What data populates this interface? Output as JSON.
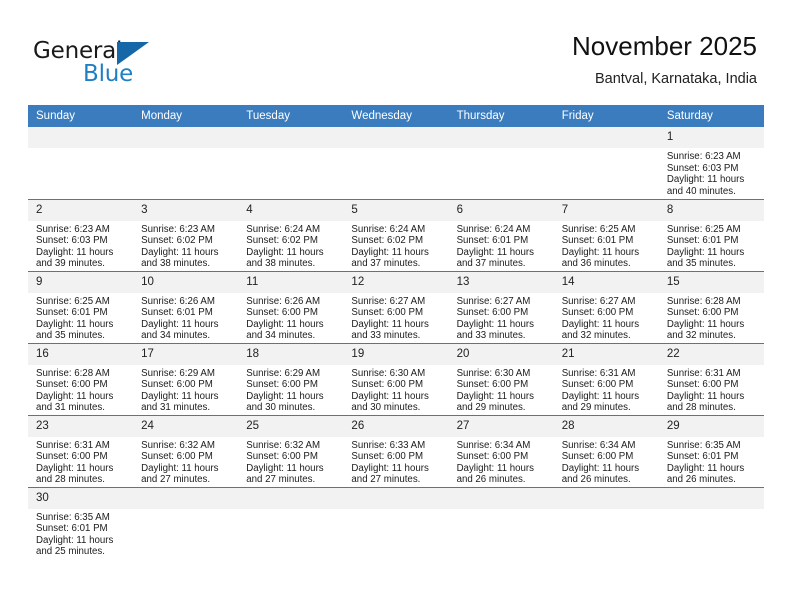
{
  "brand": {
    "name_part1": "General",
    "name_part2": "Blue",
    "logo_icon": "blue-triangle-logo",
    "accent_color": "#1567a8"
  },
  "header": {
    "title": "November 2025",
    "subtitle": "Bantval, Karnataka, India"
  },
  "calendar": {
    "header_bg": "#3a7cbe",
    "daynum_bg": "#f2f2f2",
    "weekdays": [
      "Sunday",
      "Monday",
      "Tuesday",
      "Wednesday",
      "Thursday",
      "Friday",
      "Saturday"
    ],
    "weeks": [
      [
        {
          "day": "",
          "lines": []
        },
        {
          "day": "",
          "lines": []
        },
        {
          "day": "",
          "lines": []
        },
        {
          "day": "",
          "lines": []
        },
        {
          "day": "",
          "lines": []
        },
        {
          "day": "",
          "lines": []
        },
        {
          "day": "1",
          "lines": [
            "Sunrise: 6:23 AM",
            "Sunset: 6:03 PM",
            "Daylight: 11 hours",
            "and 40 minutes."
          ]
        }
      ],
      [
        {
          "day": "2",
          "lines": [
            "Sunrise: 6:23 AM",
            "Sunset: 6:03 PM",
            "Daylight: 11 hours",
            "and 39 minutes."
          ]
        },
        {
          "day": "3",
          "lines": [
            "Sunrise: 6:23 AM",
            "Sunset: 6:02 PM",
            "Daylight: 11 hours",
            "and 38 minutes."
          ]
        },
        {
          "day": "4",
          "lines": [
            "Sunrise: 6:24 AM",
            "Sunset: 6:02 PM",
            "Daylight: 11 hours",
            "and 38 minutes."
          ]
        },
        {
          "day": "5",
          "lines": [
            "Sunrise: 6:24 AM",
            "Sunset: 6:02 PM",
            "Daylight: 11 hours",
            "and 37 minutes."
          ]
        },
        {
          "day": "6",
          "lines": [
            "Sunrise: 6:24 AM",
            "Sunset: 6:01 PM",
            "Daylight: 11 hours",
            "and 37 minutes."
          ]
        },
        {
          "day": "7",
          "lines": [
            "Sunrise: 6:25 AM",
            "Sunset: 6:01 PM",
            "Daylight: 11 hours",
            "and 36 minutes."
          ]
        },
        {
          "day": "8",
          "lines": [
            "Sunrise: 6:25 AM",
            "Sunset: 6:01 PM",
            "Daylight: 11 hours",
            "and 35 minutes."
          ]
        }
      ],
      [
        {
          "day": "9",
          "lines": [
            "Sunrise: 6:25 AM",
            "Sunset: 6:01 PM",
            "Daylight: 11 hours",
            "and 35 minutes."
          ]
        },
        {
          "day": "10",
          "lines": [
            "Sunrise: 6:26 AM",
            "Sunset: 6:01 PM",
            "Daylight: 11 hours",
            "and 34 minutes."
          ]
        },
        {
          "day": "11",
          "lines": [
            "Sunrise: 6:26 AM",
            "Sunset: 6:00 PM",
            "Daylight: 11 hours",
            "and 34 minutes."
          ]
        },
        {
          "day": "12",
          "lines": [
            "Sunrise: 6:27 AM",
            "Sunset: 6:00 PM",
            "Daylight: 11 hours",
            "and 33 minutes."
          ]
        },
        {
          "day": "13",
          "lines": [
            "Sunrise: 6:27 AM",
            "Sunset: 6:00 PM",
            "Daylight: 11 hours",
            "and 33 minutes."
          ]
        },
        {
          "day": "14",
          "lines": [
            "Sunrise: 6:27 AM",
            "Sunset: 6:00 PM",
            "Daylight: 11 hours",
            "and 32 minutes."
          ]
        },
        {
          "day": "15",
          "lines": [
            "Sunrise: 6:28 AM",
            "Sunset: 6:00 PM",
            "Daylight: 11 hours",
            "and 32 minutes."
          ]
        }
      ],
      [
        {
          "day": "16",
          "lines": [
            "Sunrise: 6:28 AM",
            "Sunset: 6:00 PM",
            "Daylight: 11 hours",
            "and 31 minutes."
          ]
        },
        {
          "day": "17",
          "lines": [
            "Sunrise: 6:29 AM",
            "Sunset: 6:00 PM",
            "Daylight: 11 hours",
            "and 31 minutes."
          ]
        },
        {
          "day": "18",
          "lines": [
            "Sunrise: 6:29 AM",
            "Sunset: 6:00 PM",
            "Daylight: 11 hours",
            "and 30 minutes."
          ]
        },
        {
          "day": "19",
          "lines": [
            "Sunrise: 6:30 AM",
            "Sunset: 6:00 PM",
            "Daylight: 11 hours",
            "and 30 minutes."
          ]
        },
        {
          "day": "20",
          "lines": [
            "Sunrise: 6:30 AM",
            "Sunset: 6:00 PM",
            "Daylight: 11 hours",
            "and 29 minutes."
          ]
        },
        {
          "day": "21",
          "lines": [
            "Sunrise: 6:31 AM",
            "Sunset: 6:00 PM",
            "Daylight: 11 hours",
            "and 29 minutes."
          ]
        },
        {
          "day": "22",
          "lines": [
            "Sunrise: 6:31 AM",
            "Sunset: 6:00 PM",
            "Daylight: 11 hours",
            "and 28 minutes."
          ]
        }
      ],
      [
        {
          "day": "23",
          "lines": [
            "Sunrise: 6:31 AM",
            "Sunset: 6:00 PM",
            "Daylight: 11 hours",
            "and 28 minutes."
          ]
        },
        {
          "day": "24",
          "lines": [
            "Sunrise: 6:32 AM",
            "Sunset: 6:00 PM",
            "Daylight: 11 hours",
            "and 27 minutes."
          ]
        },
        {
          "day": "25",
          "lines": [
            "Sunrise: 6:32 AM",
            "Sunset: 6:00 PM",
            "Daylight: 11 hours",
            "and 27 minutes."
          ]
        },
        {
          "day": "26",
          "lines": [
            "Sunrise: 6:33 AM",
            "Sunset: 6:00 PM",
            "Daylight: 11 hours",
            "and 27 minutes."
          ]
        },
        {
          "day": "27",
          "lines": [
            "Sunrise: 6:34 AM",
            "Sunset: 6:00 PM",
            "Daylight: 11 hours",
            "and 26 minutes."
          ]
        },
        {
          "day": "28",
          "lines": [
            "Sunrise: 6:34 AM",
            "Sunset: 6:00 PM",
            "Daylight: 11 hours",
            "and 26 minutes."
          ]
        },
        {
          "day": "29",
          "lines": [
            "Sunrise: 6:35 AM",
            "Sunset: 6:01 PM",
            "Daylight: 11 hours",
            "and 26 minutes."
          ]
        }
      ],
      [
        {
          "day": "30",
          "lines": [
            "Sunrise: 6:35 AM",
            "Sunset: 6:01 PM",
            "Daylight: 11 hours",
            "and 25 minutes."
          ]
        },
        {
          "day": "",
          "lines": []
        },
        {
          "day": "",
          "lines": []
        },
        {
          "day": "",
          "lines": []
        },
        {
          "day": "",
          "lines": []
        },
        {
          "day": "",
          "lines": []
        },
        {
          "day": "",
          "lines": []
        }
      ]
    ]
  }
}
